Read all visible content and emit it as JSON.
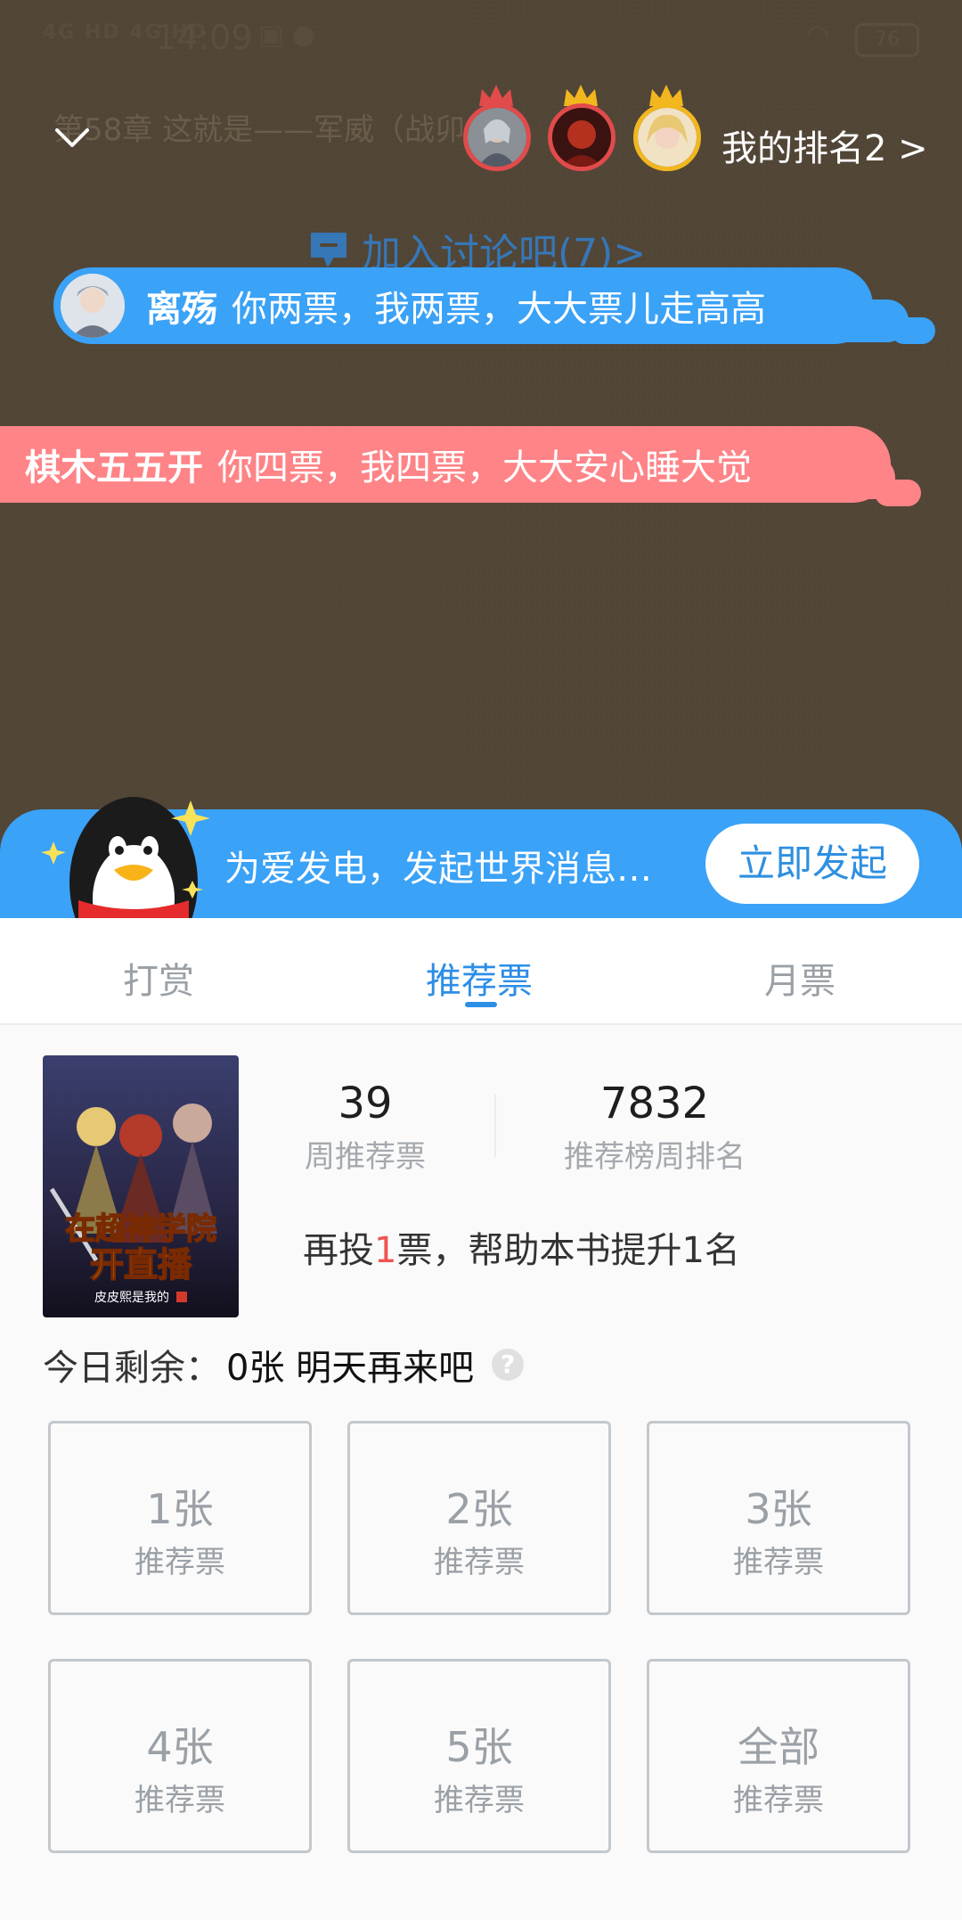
{
  "status_bar": {
    "signal": "4G HD 4G HD",
    "time": "14:09",
    "battery": "76"
  },
  "reader": {
    "chapter_title": "第58章 这就是——军威（战",
    "chapter_title_tail": "卯",
    "my_rank": "我的排名2 >",
    "join_discussion": "加入讨论吧(7)>"
  },
  "danmaku": [
    {
      "user": "离殇",
      "text": "你两票，我两票，大大票儿走高高",
      "color": "#3aa2f7"
    },
    {
      "user": "棋木五五开",
      "text": "你四票，我四票，大大安心睡大觉",
      "color": "#fe8487"
    }
  ],
  "banner": {
    "text": "为爱发电，发起世界消息…",
    "button": "立即发起"
  },
  "tabs": [
    {
      "label": "打赏",
      "active": false
    },
    {
      "label": "推荐票",
      "active": true
    },
    {
      "label": "月票",
      "active": false
    }
  ],
  "book": {
    "cover_title_line1": "在超神学院",
    "cover_title_line2": "开直播",
    "cover_author": "皮皮熙是我的"
  },
  "stats": {
    "weekly_votes": {
      "value": "39",
      "label": "周推荐票"
    },
    "weekly_rank": {
      "value": "7832",
      "label": "推荐榜周排名"
    }
  },
  "boost": {
    "prefix": "再投",
    "number": "1",
    "suffix": "票，帮助本书提升1名"
  },
  "remaining": {
    "label": "今日剩余：",
    "value": "0张 明天再来吧",
    "help": "?"
  },
  "vote_options": [
    {
      "count": "1张",
      "label": "推荐票"
    },
    {
      "count": "2张",
      "label": "推荐票"
    },
    {
      "count": "3张",
      "label": "推荐票"
    },
    {
      "count": "4张",
      "label": "推荐票"
    },
    {
      "count": "5张",
      "label": "推荐票"
    },
    {
      "count": "全部",
      "label": "推荐票"
    }
  ],
  "colors": {
    "accent": "#2d8ee6",
    "overlay_bg": "#524637",
    "banner_bg": "#3aa2f7"
  }
}
